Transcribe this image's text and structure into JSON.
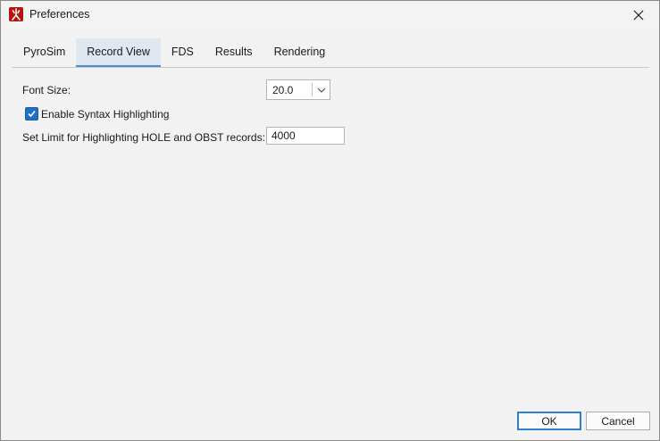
{
  "window": {
    "title": "Preferences"
  },
  "tabs": [
    {
      "label": "PyroSim",
      "active": false
    },
    {
      "label": "Record View",
      "active": true
    },
    {
      "label": "FDS",
      "active": false
    },
    {
      "label": "Results",
      "active": false
    },
    {
      "label": "Rendering",
      "active": false
    }
  ],
  "record_view": {
    "font_size_label": "Font Size:",
    "font_size_value": "20.0",
    "syntax_highlighting_label": "Enable Syntax Highlighting",
    "syntax_highlighting_checked": true,
    "limit_label": "Set Limit for Highlighting HOLE and OBST records:",
    "limit_value": "4000"
  },
  "footer": {
    "ok_label": "OK",
    "cancel_label": "Cancel"
  },
  "colors": {
    "accent": "#1f6fc5",
    "tab_underline": "#4d8fd1",
    "app_icon": "#b3150e"
  },
  "icons": {
    "app": "pyrosim-app-icon",
    "close": "close-icon",
    "dropdown": "chevron-down-icon",
    "check": "checkmark-icon"
  }
}
